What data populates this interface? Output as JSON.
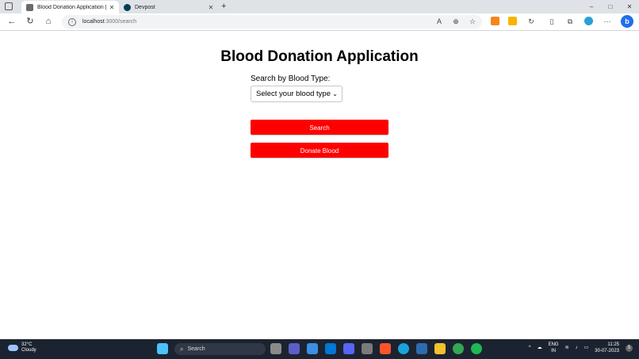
{
  "browser": {
    "tabs": [
      {
        "title": "Blood Donation Application | Se",
        "active": true,
        "favicon_color": "#6a6a6a"
      },
      {
        "title": "Devpost",
        "active": false,
        "favicon_color": "#003e54"
      }
    ],
    "new_tab_label": "+",
    "window_controls": {
      "minimize": "–",
      "maximize": "□",
      "close": "✕"
    },
    "url_host": "localhost",
    "url_rest": ":3000/search"
  },
  "page": {
    "heading": "Blood Donation Application",
    "search_label": "Search by Blood Type:",
    "select_value": "Select your blood type",
    "search_button": "Search",
    "donate_button": "Donate Blood",
    "accent_color": "#ff0000"
  },
  "taskbar": {
    "weather_temp": "32°C",
    "weather_desc": "Cloudy",
    "search_placeholder": "Search",
    "language_top": "ENG",
    "language_bottom": "IN",
    "time": "11:25",
    "date": "30-07-2023",
    "notification_count": "5"
  }
}
